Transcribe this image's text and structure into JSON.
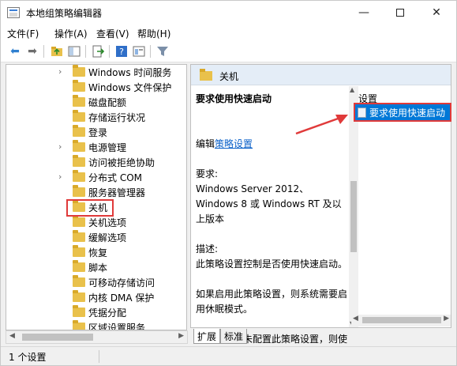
{
  "window": {
    "title": "本地组策略编辑器",
    "controls": {
      "minimize": "—",
      "maximize": "",
      "close": "✕"
    }
  },
  "menu": {
    "file": "文件(F)",
    "action": "操作(A)",
    "view": "查看(V)",
    "help": "帮助(H)"
  },
  "toolbar": {
    "icons": [
      "back-arrow-icon",
      "forward-arrow-icon",
      "up-folder-icon",
      "show-hide-tree-icon",
      "export-list-icon",
      "help-icon",
      "properties-icon",
      "filter-icon"
    ]
  },
  "tree": {
    "items": [
      {
        "label": "Windows 时间服务",
        "expandable": true
      },
      {
        "label": "Windows 文件保护",
        "expandable": false
      },
      {
        "label": "磁盘配额",
        "expandable": false
      },
      {
        "label": "存储运行状况",
        "expandable": false
      },
      {
        "label": "登录",
        "expandable": false
      },
      {
        "label": "电源管理",
        "expandable": true
      },
      {
        "label": "访问被拒绝协助",
        "expandable": false
      },
      {
        "label": "分布式 COM",
        "expandable": true
      },
      {
        "label": "服务器管理器",
        "expandable": false
      },
      {
        "label": "关机",
        "expandable": false,
        "selected": true
      },
      {
        "label": "关机选项",
        "expandable": false
      },
      {
        "label": "缓解选项",
        "expandable": false
      },
      {
        "label": "恢复",
        "expandable": false
      },
      {
        "label": "脚本",
        "expandable": false
      },
      {
        "label": "可移动存储访问",
        "expandable": false
      },
      {
        "label": "内核 DMA 保护",
        "expandable": false
      },
      {
        "label": "凭据分配",
        "expandable": false
      },
      {
        "label": "区域设置服务",
        "expandable": false
      }
    ]
  },
  "details": {
    "header": "关机",
    "policy_title": "要求使用快速启动",
    "edit_prefix": "编辑",
    "edit_link": "策略设置",
    "requirements_label": "要求:",
    "requirements_text": "Windows Server 2012、Windows 8 或 Windows RT 及以上版本",
    "description_label": "描述:",
    "description_text": "此策略设置控制是否使用快速启动。",
    "enabled_text": "如果启用此策略设置，则系统需要启用休眠模式。",
    "disabled_text": "如果禁用或未配置此策略设置，则使用本地设置。",
    "settings_header": "设置",
    "settings_item": "要求使用快速启动"
  },
  "tabs": {
    "extended": "扩展",
    "standard": "标准"
  },
  "status": {
    "text": "1 个设置"
  },
  "colors": {
    "accent": "#0078d7",
    "annotation": "#e03a3a",
    "link": "#0d62c9",
    "header_bg": "#e4edf7"
  }
}
